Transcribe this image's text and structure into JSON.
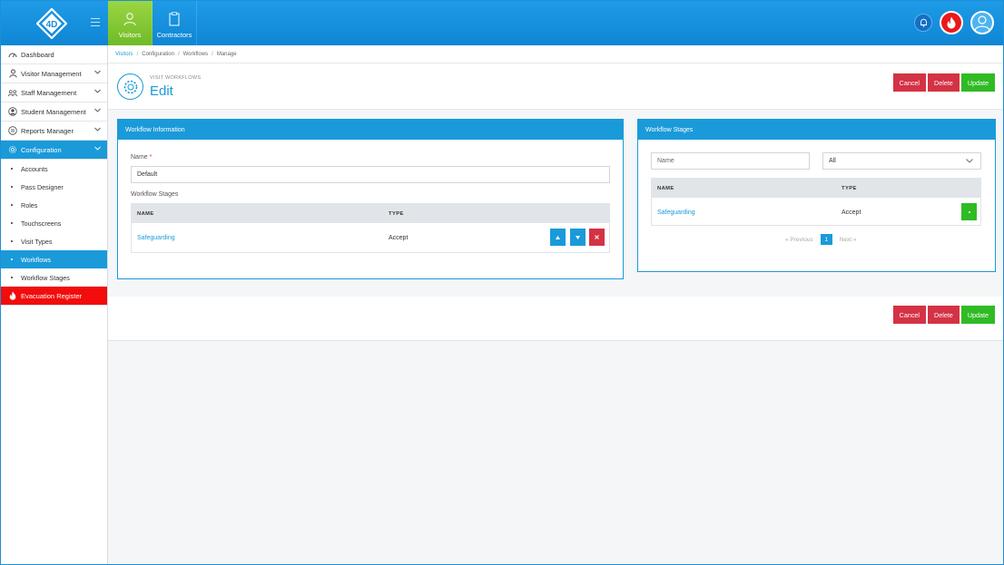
{
  "topnav": {
    "items": [
      {
        "label": "Visitors",
        "icon": "visitor-person-icon"
      },
      {
        "label": "Contractors",
        "icon": "clipboard-icon"
      }
    ]
  },
  "sidebar": {
    "items": [
      {
        "label": "Dashboard"
      },
      {
        "label": "Visitor Management"
      },
      {
        "label": "Staff Management"
      },
      {
        "label": "Student Management"
      },
      {
        "label": "Reports Manager"
      },
      {
        "label": "Configuration"
      }
    ],
    "sub_items": [
      {
        "label": "Accounts"
      },
      {
        "label": "Pass Designer"
      },
      {
        "label": "Roles"
      },
      {
        "label": "Touchscreens"
      },
      {
        "label": "Visit Types"
      },
      {
        "label": "Workflows"
      },
      {
        "label": "Workflow Stages"
      }
    ],
    "evacuation": "Evacuation Register"
  },
  "breadcrumb": [
    "Visitors",
    "Configuration",
    "Workflows",
    "Manage"
  ],
  "header": {
    "subtitle": "VISIT WORKFLOWS",
    "title": "Edit"
  },
  "actions": {
    "cancel": "Cancel",
    "delete": "Delete",
    "update": "Update"
  },
  "workflow_info": {
    "title": "Workflow Information",
    "name_label": "Name",
    "required_mark": "*",
    "name_value": "Default",
    "stages_label": "Workflow Stages",
    "columns": [
      "NAME",
      "TYPE"
    ],
    "rows": [
      {
        "name": "Safeguarding",
        "type": "Accept"
      }
    ]
  },
  "workflow_stages": {
    "title": "Workflow Stages",
    "name_placeholder": "Name",
    "filter_value": "All",
    "columns": [
      "NAME",
      "TYPE"
    ],
    "rows": [
      {
        "name": "Safeguarding",
        "type": "Accept"
      }
    ],
    "pager": {
      "previous": "Previous",
      "page": "1",
      "next": "Next"
    }
  },
  "colors": {
    "primary": "#1a9ad9",
    "danger": "#d43245",
    "success": "#2fbb24",
    "evacuation": "#f20c0c"
  }
}
